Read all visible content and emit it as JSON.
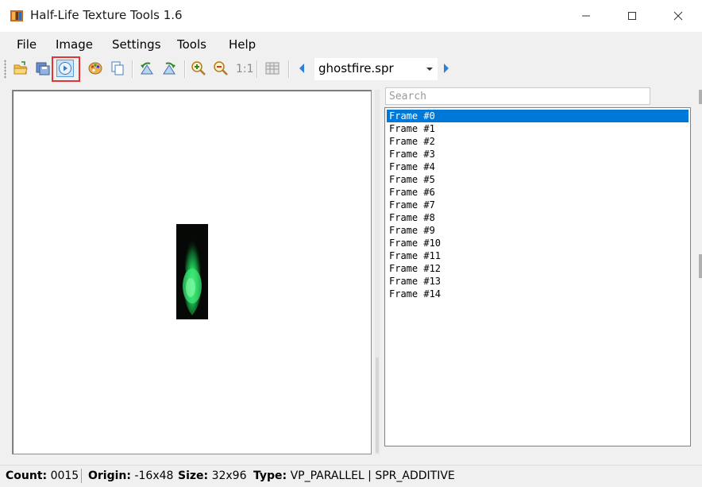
{
  "window": {
    "title": "Half-Life Texture Tools 1.6",
    "controls": [
      "minimize",
      "maximize",
      "close"
    ]
  },
  "menu": [
    "File",
    "Image",
    "Settings",
    "Tools",
    "Help"
  ],
  "toolbar": {
    "buttons": [
      "open-folder-icon",
      "save-icon",
      "play-icon",
      "palette-icon",
      "copy-icon",
      "rotate-left-icon",
      "rotate-right-icon",
      "zoom-in-icon",
      "zoom-out-icon",
      "grid-icon",
      "prev-arrow-icon",
      "next-arrow-icon"
    ],
    "zoom_reset_label": "1:1",
    "file_select": {
      "value": "ghostfire.spr"
    }
  },
  "search": {
    "placeholder": "Search"
  },
  "frames": {
    "items": [
      "Frame #0",
      "Frame #1",
      "Frame #2",
      "Frame #3",
      "Frame #4",
      "Frame #5",
      "Frame #6",
      "Frame #7",
      "Frame #8",
      "Frame #9",
      "Frame #10",
      "Frame #11",
      "Frame #12",
      "Frame #13",
      "Frame #14"
    ],
    "selected": "Frame #0"
  },
  "status": {
    "count_label": "Count:",
    "count_value": "0015",
    "origin_label": "Origin:",
    "origin_value": "-16x48",
    "size_label": "Size:",
    "size_value": "32x96",
    "type_label": "Type:",
    "type_value": "VP_PARALLEL | SPR_ADDITIVE"
  },
  "colors": {
    "selection": "#0078d7",
    "highlight_border": "#e23434",
    "sprite_glow": "#2ee06a"
  }
}
